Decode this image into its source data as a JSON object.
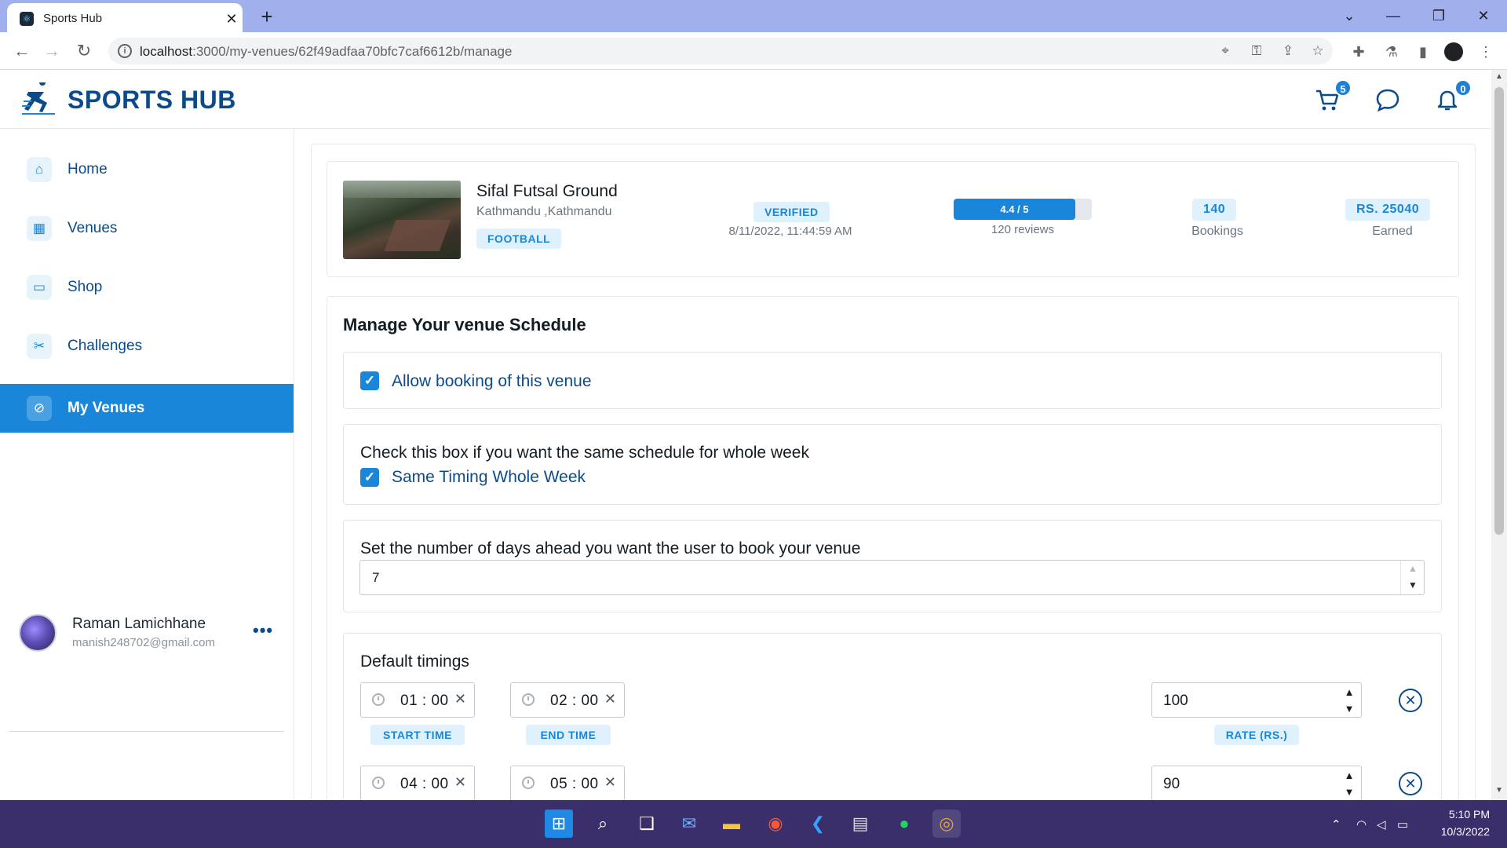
{
  "browser": {
    "tab_title": "Sports Hub",
    "url_host": "localhost",
    "url_rest": ":3000/my-venues/62f49adfaa70bfc7caf6612b/manage"
  },
  "header": {
    "logo_text": "SPORTS HUB",
    "cart_count": "5",
    "notification_count": "0"
  },
  "sidebar": {
    "items": [
      {
        "label": "Home",
        "icon": "home-icon"
      },
      {
        "label": "Venues",
        "icon": "calendar-icon"
      },
      {
        "label": "Shop",
        "icon": "card-icon"
      },
      {
        "label": "Challenges",
        "icon": "crossed-tools-icon"
      },
      {
        "label": "My Venues",
        "icon": "compass-icon",
        "active": true
      }
    ],
    "user": {
      "name": "Raman Lamichhane",
      "email": "manish248702@gmail.com"
    }
  },
  "venue": {
    "name": "Sifal Futsal Ground",
    "location": "Kathmandu ,Kathmandu",
    "sport": "FOOTBALL",
    "status": "VERIFIED",
    "date": "8/11/2022, 11:44:59 AM",
    "rating_text": "4.4 / 5",
    "rating_fraction": 0.88,
    "reviews": "120 reviews",
    "bookings_value": "140",
    "bookings_label": "Bookings",
    "earned_value": "RS. 25040",
    "earned_label": "Earned"
  },
  "schedule": {
    "title": "Manage Your venue Schedule",
    "allow_booking_label": "Allow booking of this venue",
    "allow_booking_checked": true,
    "same_week_heading": "Check this box if you want the same schedule for whole week",
    "same_week_label": "Same Timing Whole Week",
    "same_week_checked": true,
    "days_ahead_heading": "Set the number of days ahead you want the user to book your venue",
    "days_ahead_value": "7",
    "default_timings_title": "Default timings",
    "start_time_label": "START TIME",
    "end_time_label": "END TIME",
    "rate_label": "RATE (RS.)",
    "slots": [
      {
        "start": "01 : 00",
        "end": "02 : 00",
        "rate": "100"
      },
      {
        "start": "04 : 00",
        "end": "05 : 00",
        "rate": "90"
      }
    ]
  },
  "taskbar": {
    "time": "5:10 PM",
    "date": "10/3/2022"
  }
}
